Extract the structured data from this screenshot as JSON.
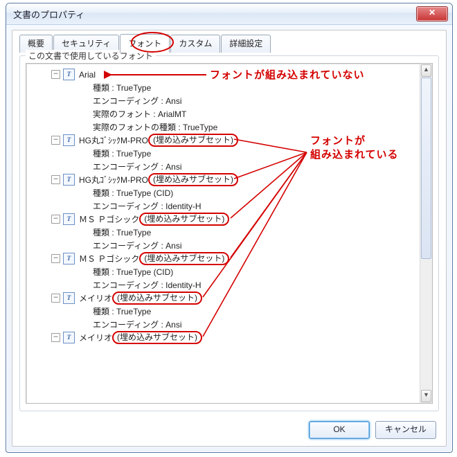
{
  "window": {
    "title": "文書のプロパティ",
    "close": "✕"
  },
  "tabs": {
    "items": [
      "概要",
      "セキュリティ",
      "フォント",
      "カスタム",
      "詳細設定"
    ],
    "active_index": 2
  },
  "groupbox_label": "この文書で使用しているフォント",
  "buttons": {
    "ok": "OK",
    "cancel": "キャンセル"
  },
  "annotations": {
    "not_embedded": "フォントが組み込まれていない",
    "embedded_line1": "フォントが",
    "embedded_line2": "組み込まれている"
  },
  "embedded_tag": "(埋め込みサブセット)",
  "fonts": [
    {
      "name": "Arial",
      "embedded": false,
      "details": [
        "種類 : TrueType",
        "エンコーディング : Ansi",
        "実際のフォント : ArialMT",
        "実際のフォントの種類 : TrueType"
      ]
    },
    {
      "name": "HG丸ｺﾞｼｯｸM-PRO",
      "embedded": true,
      "details": [
        "種類 : TrueType",
        "エンコーディング : Ansi"
      ]
    },
    {
      "name": "HG丸ｺﾞｼｯｸM-PRO",
      "embedded": true,
      "details": [
        "種類 : TrueType (CID)",
        "エンコーディング : Identity-H"
      ]
    },
    {
      "name": "ＭＳ Ｐゴシック",
      "embedded": true,
      "details": [
        "種類 : TrueType",
        "エンコーディング : Ansi"
      ]
    },
    {
      "name": "ＭＳ Ｐゴシック",
      "embedded": true,
      "details": [
        "種類 : TrueType (CID)",
        "エンコーディング : Identity-H"
      ]
    },
    {
      "name": "メイリオ",
      "embedded": true,
      "details": [
        "種類 : TrueType",
        "エンコーディング : Ansi"
      ]
    },
    {
      "name": "メイリオ",
      "embedded": true,
      "details": []
    }
  ]
}
